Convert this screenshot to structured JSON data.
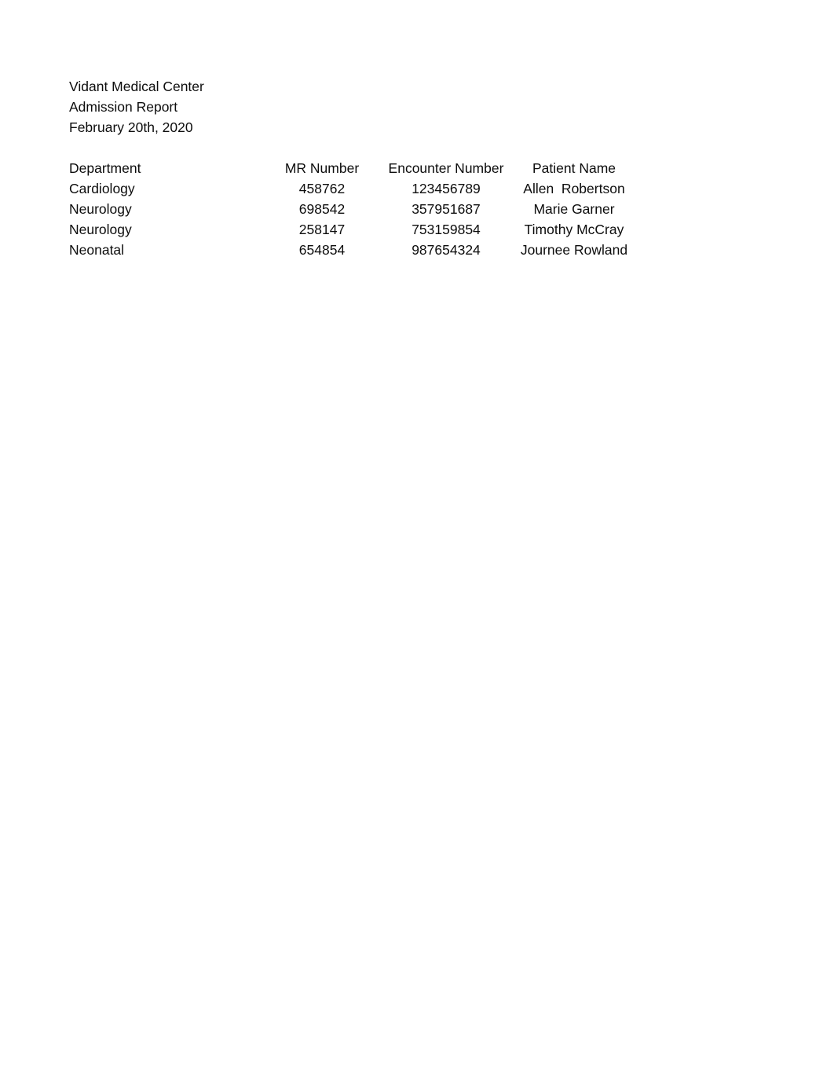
{
  "document": {
    "organization": "Vidant Medical Center",
    "report_title": "Admission Report",
    "report_date": "February 20th, 2020"
  },
  "table": {
    "columns": [
      {
        "key": "department",
        "label": "Department",
        "align": "left"
      },
      {
        "key": "mr_number",
        "label": "MR Number",
        "align": "center"
      },
      {
        "key": "encounter_number",
        "label": "Encounter Number",
        "align": "center"
      },
      {
        "key": "patient_name",
        "label": "Patient Name",
        "align": "center"
      }
    ],
    "rows": [
      {
        "department": "Cardiology",
        "mr_number": "458762",
        "encounter_number": "123456789",
        "patient_name": "Allen  Robertson"
      },
      {
        "department": "Neurology",
        "mr_number": "698542",
        "encounter_number": "357951687",
        "patient_name": "Marie Garner"
      },
      {
        "department": "Neurology",
        "mr_number": "258147",
        "encounter_number": "753159854",
        "patient_name": "Timothy McCray"
      },
      {
        "department": "Neonatal",
        "mr_number": "654854",
        "encounter_number": "987654324",
        "patient_name": "Journee Rowland"
      }
    ]
  },
  "colors": {
    "page_background": "#ffffff",
    "text": "#0d0d0d"
  }
}
